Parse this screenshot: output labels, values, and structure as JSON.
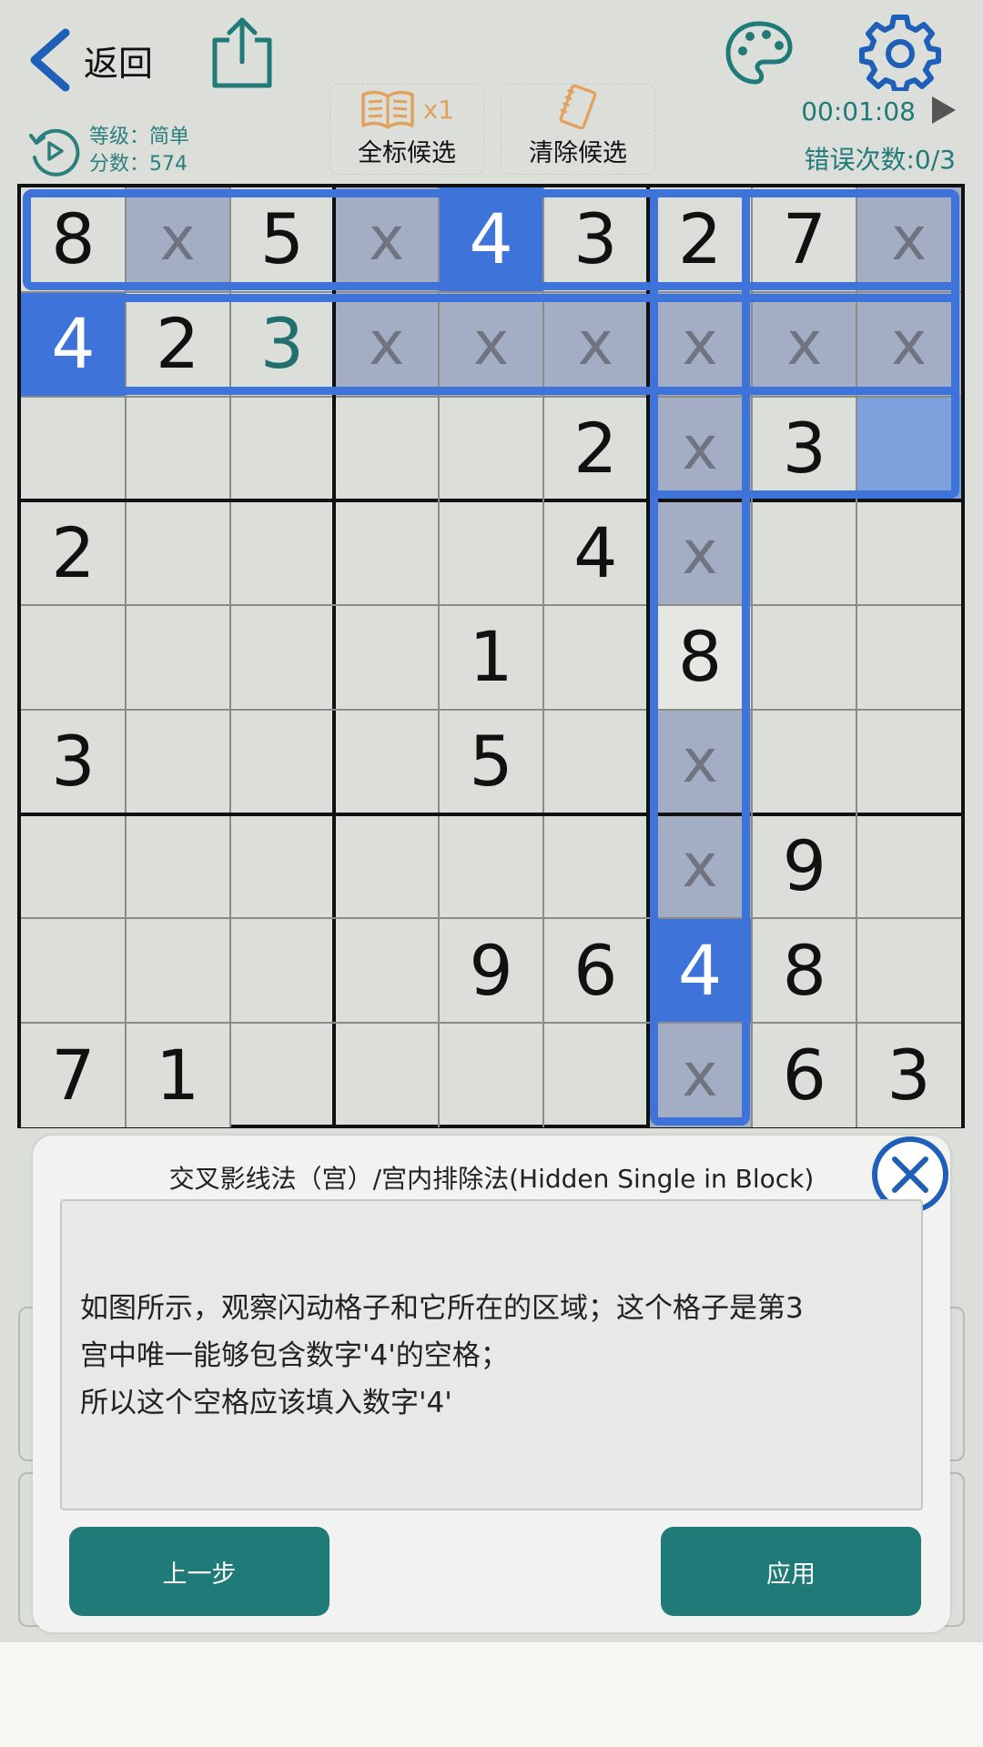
{
  "header": {
    "back_label": "返回",
    "timer": "00:01:08",
    "errors": "错误次数:0/3",
    "level": "等级：简单",
    "score": "分数：574"
  },
  "tools": {
    "mark_all_label": "全标候选",
    "mark_all_multiplier": "x1",
    "clear_label": "清除候选"
  },
  "colors": {
    "accent_teal": "#1f7a78",
    "highlight_blue": "#3e74d9",
    "elim_cell": "#a3adc3",
    "target_cell": "#7ea0dc",
    "user_digit": "#22706d"
  },
  "board": {
    "cells": [
      [
        "8",
        "x",
        "5",
        "x",
        "4",
        "3",
        "2",
        "7",
        "x"
      ],
      [
        "4",
        "2",
        "3",
        "x",
        "x",
        "x",
        "x",
        "x",
        "x"
      ],
      [
        "",
        "",
        "",
        "",
        "",
        "2",
        "x",
        "3",
        ""
      ],
      [
        "2",
        "",
        "",
        "",
        "",
        "4",
        "x",
        "",
        ""
      ],
      [
        "",
        "",
        "",
        "",
        "1",
        "",
        "8",
        "",
        ""
      ],
      [
        "3",
        "",
        "",
        "",
        "5",
        "",
        "x",
        "",
        ""
      ],
      [
        "",
        "",
        "",
        "",
        "",
        "",
        "x",
        "9",
        ""
      ],
      [
        "",
        "",
        "",
        "",
        "9",
        "6",
        "4",
        "8",
        ""
      ],
      [
        "7",
        "1",
        "",
        "",
        "",
        "",
        "x",
        "6",
        "3"
      ]
    ],
    "styles": [
      [
        "g",
        "e",
        "g",
        "e",
        "S",
        "g",
        "g",
        "g",
        "e"
      ],
      [
        "S",
        "g",
        "u",
        "e",
        "e",
        "e",
        "e",
        "e",
        "e"
      ],
      [
        "n",
        "n",
        "n",
        "n",
        "n",
        "g",
        "e",
        "g",
        "T"
      ],
      [
        "g",
        "n",
        "n",
        "n",
        "n",
        "g",
        "e",
        "n",
        "n"
      ],
      [
        "n",
        "n",
        "n",
        "n",
        "g",
        "n",
        "w",
        "n",
        "n"
      ],
      [
        "g",
        "n",
        "n",
        "n",
        "g",
        "n",
        "e",
        "n",
        "n"
      ],
      [
        "n",
        "n",
        "n",
        "n",
        "n",
        "n",
        "e",
        "g",
        "n"
      ],
      [
        "n",
        "n",
        "n",
        "n",
        "g",
        "g",
        "S",
        "g",
        "n"
      ],
      [
        "g",
        "g",
        "n",
        "n",
        "n",
        "n",
        "e",
        "g",
        "g"
      ]
    ]
  },
  "popup": {
    "title": "交叉影线法（宫）/宫内排除法(Hidden Single in Block)",
    "hint_lines": [
      "如图所示，观察闪动格子和它所在的区域；这个格子是第3",
      "宫中唯一能够包含数字'4'的空格；",
      "所以这个空格应该填入数字'4'"
    ],
    "prev_label": "上一步",
    "apply_label": "应用"
  }
}
